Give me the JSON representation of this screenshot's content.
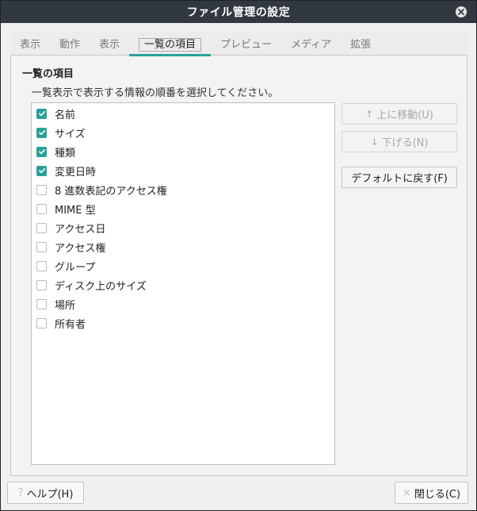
{
  "window": {
    "title": "ファイル管理の設定",
    "close_icon": "close-icon"
  },
  "tabs": [
    {
      "label": "表示"
    },
    {
      "label": "動作"
    },
    {
      "label": "表示"
    },
    {
      "label": "一覧の項目",
      "active": true
    },
    {
      "label": "プレビュー"
    },
    {
      "label": "メディア"
    },
    {
      "label": "拡張"
    }
  ],
  "section": {
    "title": "一覧の項目",
    "instruction": "一覧表示で表示する情報の順番を選択してください。"
  },
  "columns": [
    {
      "label": "名前",
      "checked": true
    },
    {
      "label": "サイズ",
      "checked": true
    },
    {
      "label": "種類",
      "checked": true
    },
    {
      "label": "変更日時",
      "checked": true
    },
    {
      "label": "8 進数表記のアクセス権",
      "checked": false
    },
    {
      "label": "MIME 型",
      "checked": false
    },
    {
      "label": "アクセス日",
      "checked": false
    },
    {
      "label": "アクセス権",
      "checked": false
    },
    {
      "label": "グループ",
      "checked": false
    },
    {
      "label": "ディスク上のサイズ",
      "checked": false
    },
    {
      "label": "場所",
      "checked": false
    },
    {
      "label": "所有者",
      "checked": false
    }
  ],
  "buttons": {
    "move_up": "上に移動(U)",
    "move_down": "下げる(N)",
    "reset_default": "デフォルトに戻す(F)",
    "help": "ヘルプ(H)",
    "close": "閉じる(C)"
  },
  "colors": {
    "accent": "#2aa198",
    "titlebar": "#323840"
  }
}
